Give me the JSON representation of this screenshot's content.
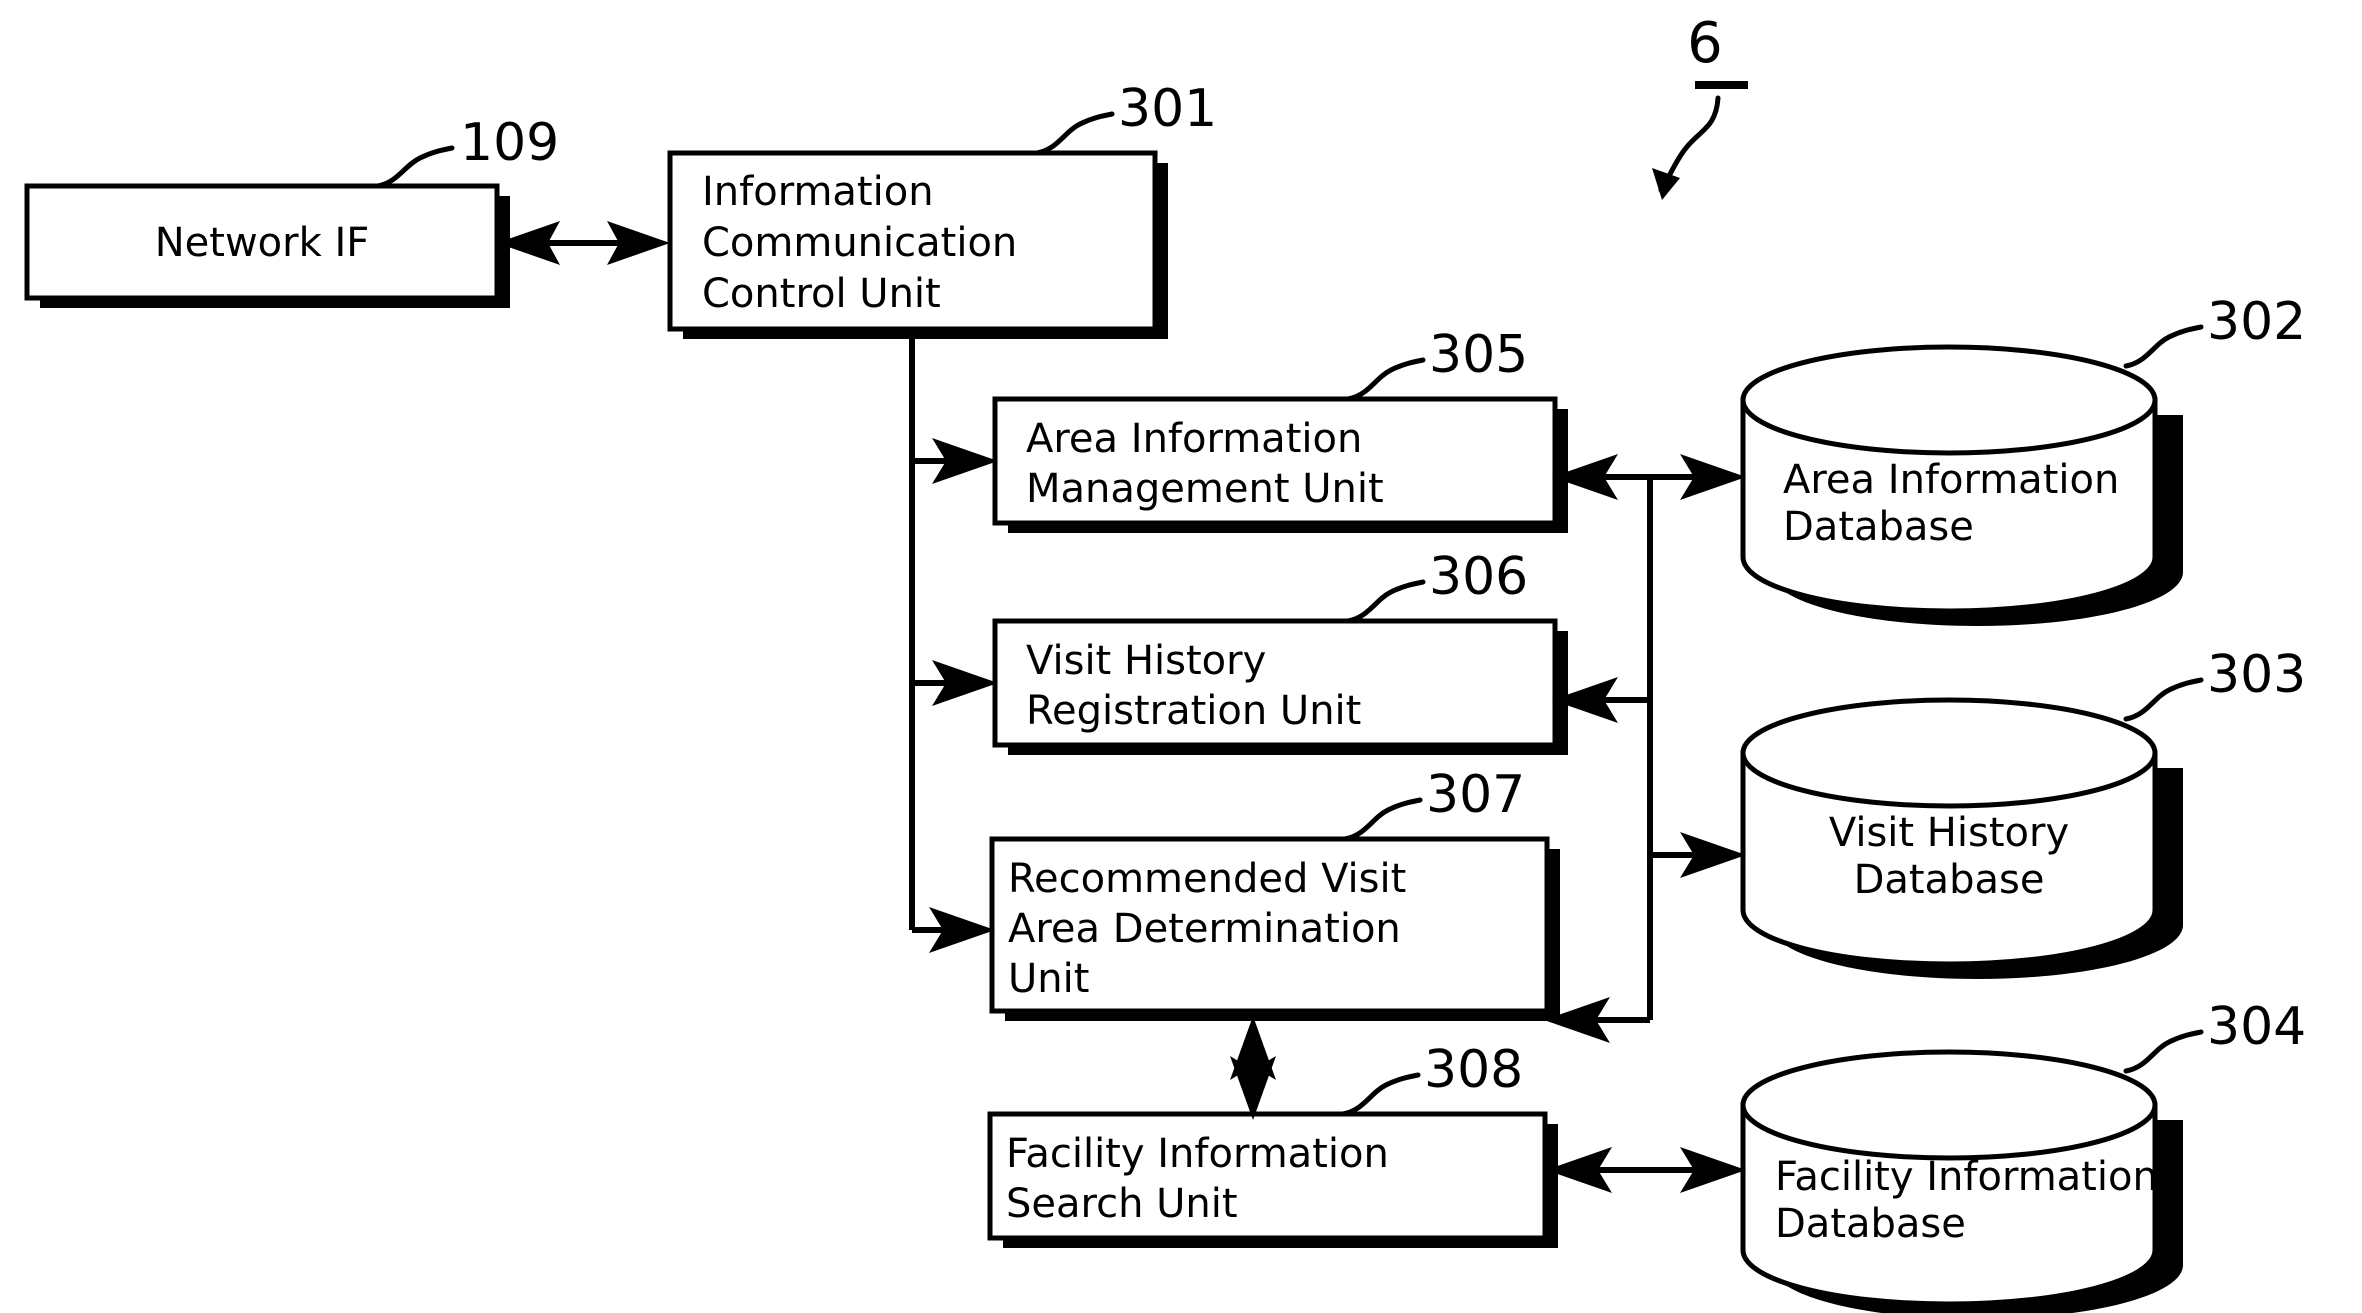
{
  "figure": {
    "number": "6",
    "caption_style": "underlined-figure-number-with-curved-arrow"
  },
  "colors": {
    "line": "#000000",
    "fill": "#ffffff",
    "shadow": "#000000"
  },
  "blocks": [
    {
      "id": "network-if",
      "ref": "109",
      "lines": [
        "Network IF"
      ],
      "shape": "rectangle",
      "align": "center"
    },
    {
      "id": "information-communication-control-unit",
      "ref": "301",
      "lines": [
        "Information",
        "Communication",
        "Control Unit"
      ],
      "shape": "rectangle",
      "align": "left"
    },
    {
      "id": "area-information-management-unit",
      "ref": "305",
      "lines": [
        "Area Information",
        "Management Unit"
      ],
      "shape": "rectangle",
      "align": "left"
    },
    {
      "id": "visit-history-registration-unit",
      "ref": "306",
      "lines": [
        "Visit History",
        "Registration Unit"
      ],
      "shape": "rectangle",
      "align": "left"
    },
    {
      "id": "recommended-visit-area-determination-unit",
      "ref": "307",
      "lines": [
        "Recommended Visit",
        "Area Determination",
        "Unit"
      ],
      "shape": "rectangle",
      "align": "left"
    },
    {
      "id": "facility-information-search-unit",
      "ref": "308",
      "lines": [
        "Facility Information",
        "Search Unit"
      ],
      "shape": "rectangle",
      "align": "left"
    }
  ],
  "databases": [
    {
      "id": "area-information-database",
      "ref": "302",
      "lines": [
        "Area Information",
        "Database"
      ],
      "shape": "cylinder",
      "align": "left"
    },
    {
      "id": "visit-history-database",
      "ref": "303",
      "lines": [
        "Visit History",
        "Database"
      ],
      "shape": "cylinder",
      "align": "center"
    },
    {
      "id": "facility-information-database",
      "ref": "304",
      "lines": [
        "Facility Information",
        "Database"
      ],
      "shape": "cylinder",
      "align": "left"
    }
  ],
  "connections": [
    {
      "from": "network-if",
      "to": "information-communication-control-unit",
      "type": "bidirectional"
    },
    {
      "from": "information-communication-control-unit",
      "to": "area-information-management-unit",
      "type": "unidirectional"
    },
    {
      "from": "information-communication-control-unit",
      "to": "visit-history-registration-unit",
      "type": "unidirectional"
    },
    {
      "from": "information-communication-control-unit",
      "to": "recommended-visit-area-determination-unit",
      "type": "unidirectional"
    },
    {
      "from": "area-information-management-unit",
      "to": "area-information-database",
      "type": "bidirectional"
    },
    {
      "from": "area-information-database",
      "to": "visit-history-registration-unit",
      "type": "unidirectional"
    },
    {
      "from": "area-information-database",
      "to": "recommended-visit-area-determination-unit",
      "type": "unidirectional"
    },
    {
      "from": "visit-history-registration-unit",
      "to": "visit-history-database",
      "type": "unidirectional"
    },
    {
      "from": "recommended-visit-area-determination-unit",
      "to": "facility-information-search-unit",
      "type": "bidirectional"
    },
    {
      "from": "facility-information-search-unit",
      "to": "facility-information-database",
      "type": "bidirectional"
    }
  ]
}
